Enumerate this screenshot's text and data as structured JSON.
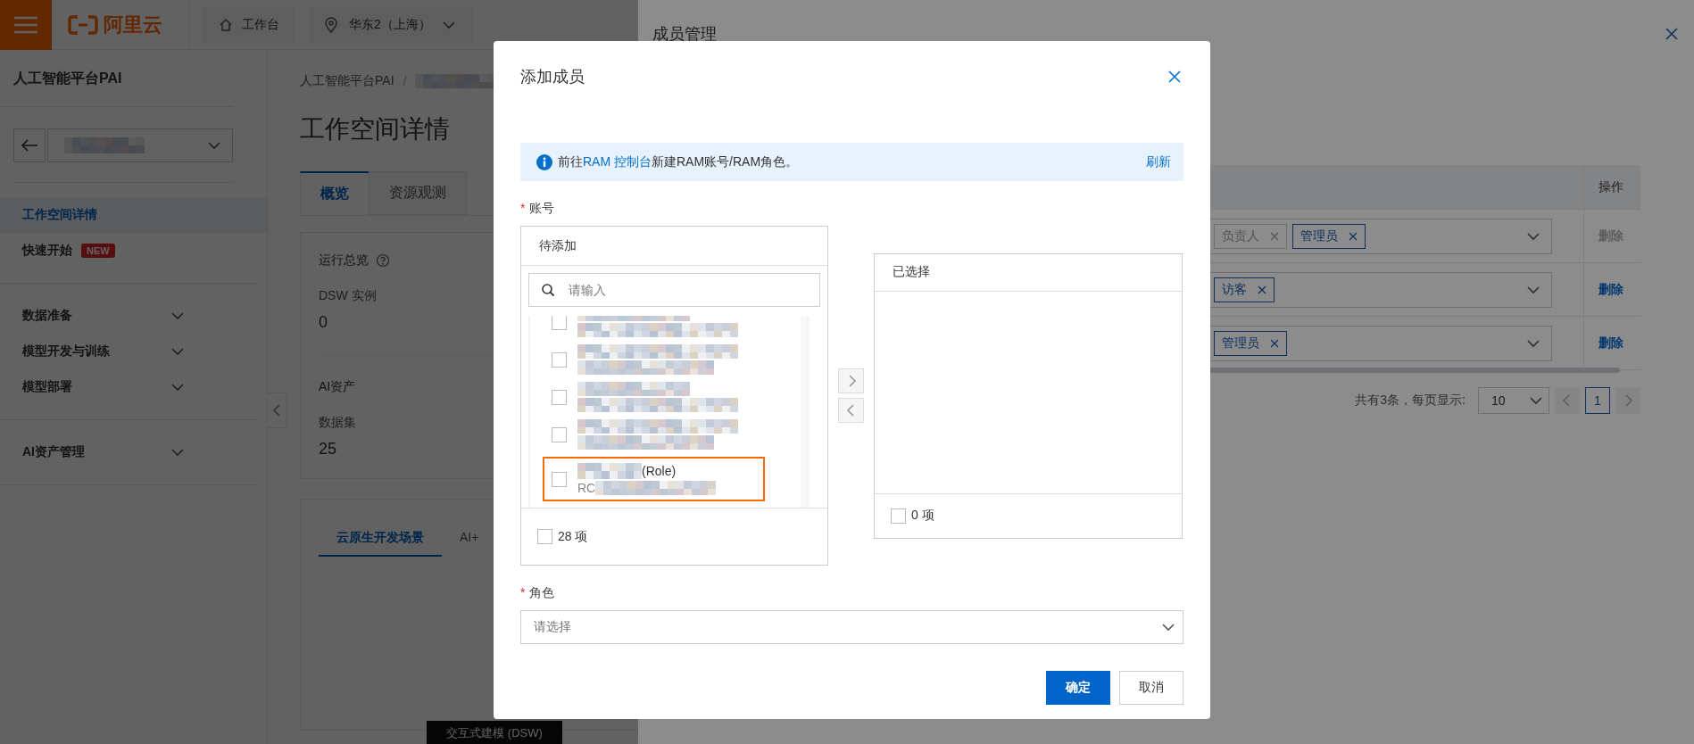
{
  "header": {
    "logo": "阿里云",
    "workbench": "工作台",
    "region": "华东2（上海）"
  },
  "sidebar": {
    "title": "人工智能平台PAI",
    "sections": [
      {
        "items": [
          {
            "kind": "link",
            "label": "工作空间详情",
            "selected": true
          },
          {
            "kind": "link",
            "label": "快速开始",
            "badge": "NEW",
            "selected": false
          }
        ]
      },
      {
        "items": [
          {
            "kind": "group",
            "label": "数据准备",
            "expanded": false
          },
          {
            "kind": "group",
            "label": "模型开发与训练",
            "expanded": false
          },
          {
            "kind": "group",
            "label": "模型部署",
            "expanded": false
          }
        ]
      },
      {
        "items": [
          {
            "kind": "group",
            "label": "AI资产管理",
            "expanded": false
          }
        ]
      }
    ]
  },
  "main": {
    "breadcrumb": {
      "root": "人工智能平台PAI",
      "separator": "/"
    },
    "title": "工作空间详情",
    "tabs": [
      {
        "label": "概览",
        "selected": true
      },
      {
        "label": "资源观测",
        "selected": false
      }
    ],
    "overview": {
      "title": "运行总览",
      "stats": [
        {
          "label": "DSW 实例",
          "value": "0"
        }
      ],
      "assets_title": "AI资产",
      "asset_stats": [
        {
          "label": "数据集",
          "value": "25"
        }
      ]
    },
    "scenario_tabs": [
      {
        "label": "云原生开发场景",
        "selected": true
      },
      {
        "label": "AI+",
        "selected": false
      }
    ],
    "bottom_button": "交互式建模 (DSW)"
  },
  "drawer": {
    "title": "成员管理",
    "action_column": "操作",
    "rows": [
      {
        "roles": [
          {
            "label": "负责人",
            "kind": "fixed"
          },
          {
            "label": "管理员",
            "kind": "role"
          }
        ],
        "action": "删除",
        "disabled": true
      },
      {
        "roles": [
          {
            "label": "访客",
            "kind": "role"
          }
        ],
        "action": "删除",
        "disabled": false
      },
      {
        "roles": [
          {
            "label": "管理员",
            "kind": "role"
          }
        ],
        "action": "删除",
        "disabled": false
      }
    ],
    "pagination": {
      "summary": "共有3条，每页显示:",
      "page_size": "10",
      "pages": [
        {
          "label": "1",
          "selected": true
        }
      ]
    }
  },
  "modal": {
    "title": "添加成员",
    "alert": {
      "prefix": "前往",
      "link": "RAM 控制台",
      "suffix": "新建RAM账号/RAM角色。",
      "action": "刷新"
    },
    "account_field": {
      "label": "账号",
      "required": true,
      "required_mark": "*"
    },
    "transfer": {
      "source": {
        "title": "待添加",
        "search_placeholder": "请输入",
        "items": [
          {
            "kind": "redacted",
            "checked": false,
            "highlighted": false
          },
          {
            "kind": "redacted",
            "checked": false,
            "highlighted": false
          },
          {
            "kind": "redacted",
            "checked": false,
            "highlighted": false
          },
          {
            "kind": "redacted",
            "checked": false,
            "highlighted": false
          },
          {
            "kind": "partial",
            "name": "(Role)",
            "id": "RC",
            "checked": false,
            "highlighted": true
          }
        ],
        "count": "28 项",
        "all_checked": false
      },
      "target": {
        "title": "已选择",
        "count": "0 项",
        "all_checked": false
      }
    },
    "role_field": {
      "label": "角色",
      "required": true,
      "required_mark": "*",
      "placeholder": "请选择"
    },
    "buttons": [
      {
        "label": "确定",
        "kind": "primary"
      },
      {
        "label": "取消",
        "kind": "secondary"
      }
    ]
  }
}
